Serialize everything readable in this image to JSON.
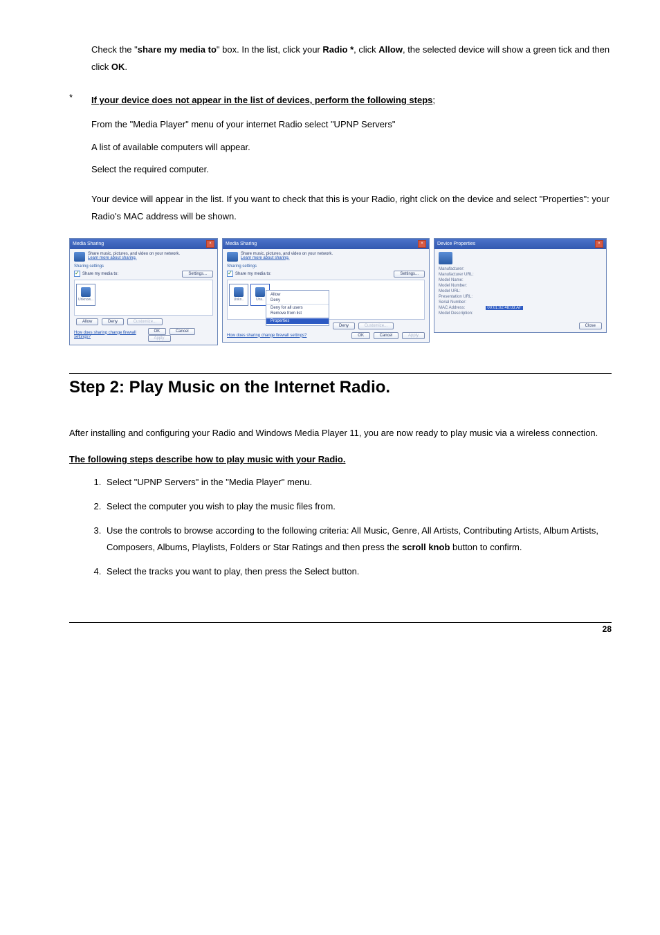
{
  "p1_a": "Check the \"",
  "p1_b": "share my media to",
  "p1_c": "\" box. In the list, click your ",
  "p1_d": "Radio *",
  "p1_e": ", click ",
  "p1_f": "Allow",
  "p1_g": ", the selected device will show a green tick and then click ",
  "p1_h": "OK",
  "p1_i": ".",
  "p2_ast": "*",
  "p2_head": "If your device does not appear in the list of devices, perform the following steps",
  "p2_semi": ";",
  "p3": "From the \"Media Player\" menu of your internet Radio select \"UPNP Servers\"",
  "p4": "A list of available computers will appear.",
  "p5": "Select the required computer.",
  "p6": "Your device will appear in the list.  If you want to check that this is your Radio, right click on the device and select \"Properties\": your Radio's MAC address will be shown.",
  "ss1": {
    "title": "Media Sharing",
    "desc": "Share music, pictures, and video on your network.",
    "learn": "Learn more about sharing.",
    "section": "Sharing settings",
    "chk": "Share my media to:",
    "settings": "Settings...",
    "device_label": "Unknow...",
    "allow": "Allow",
    "deny": "Deny",
    "customize": "Customize...",
    "footer_link": "How does sharing change firewall settings?",
    "ok": "OK",
    "cancel": "Cancel",
    "apply": "Apply"
  },
  "ss2": {
    "title": "Media Sharing",
    "desc": "Share music, pictures, and video on your network.",
    "learn": "Learn more about sharing.",
    "section": "Sharing settings",
    "chk": "Share my media to:",
    "settings": "Settings...",
    "device1": "Unkn..",
    "device2": "Uns..",
    "btn_deny": "Deny",
    "btn_customize": "Customize...",
    "menu_allow": "Allow",
    "menu_deny": "Deny",
    "menu_denyall": "Deny for all users",
    "menu_remove": "Remove from list",
    "menu_props": "Properties",
    "footer_link": "How does sharing change firewall settings?",
    "ok": "OK",
    "cancel": "Cancel",
    "apply": "Apply"
  },
  "ss3": {
    "title": "Device Properties",
    "f1": "Manufacturer:",
    "f2": "Manufacturer URL:",
    "f3": "Model Name:",
    "f4": "Model Number:",
    "f5": "Model URL:",
    "f6": "Presentation URL:",
    "f7": "Serial Number:",
    "f8": "MAC Address:",
    "mac": "00:01:02:48:03:AF",
    "f9": "Model Description:",
    "close": "Close"
  },
  "h2": "Step 2: Play Music on the Internet Radio.",
  "p7": "After installing and configuring your Radio and Windows Media Player 11, you are now ready to play music via a wireless connection.",
  "sub": "The following steps describe how to play music with your Radio.",
  "li1": "Select \"UPNP Servers\" in the \"Media Player\" menu.",
  "li2": "Select the computer you wish to play the music files from.",
  "li3_a": "Use the controls to browse according to the following criteria: All Music, Genre, All Artists, Contributing Artists, Album Artists, Composers, Albums, Playlists, Folders or Star Ratings and then press the ",
  "li3_b": "scroll knob",
  "li3_c": " button to confirm.",
  "li4": "Select the tracks you want to play, then press the Select button.",
  "page": "28"
}
